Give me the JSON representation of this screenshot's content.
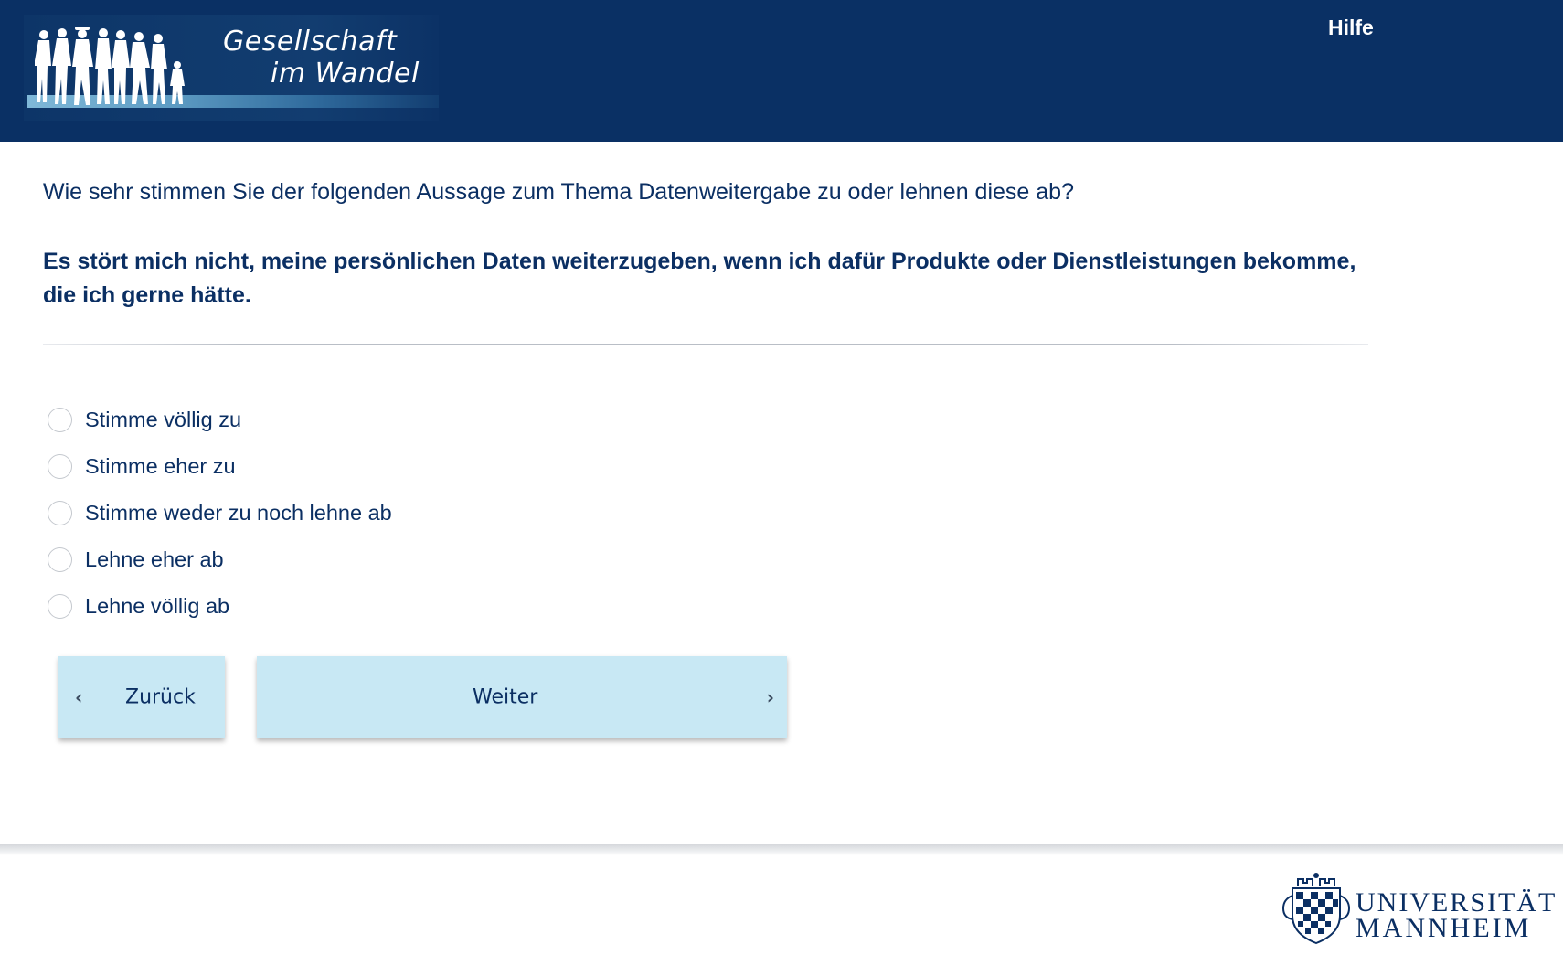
{
  "header": {
    "logo": {
      "line1": "Gesellschaft",
      "line2": "im Wandel"
    },
    "help_label": "Hilfe"
  },
  "question": {
    "text": "Wie sehr stimmen Sie der folgenden Aussage zum Thema Datenweitergabe zu oder lehnen diese ab?",
    "statement": "Es stört mich nicht, meine persönlichen Daten weiterzugeben, wenn ich dafür Produkte oder Dienstleistungen bekomme, die ich gerne hätte."
  },
  "options": [
    {
      "label": "Stimme völlig zu",
      "selected": false
    },
    {
      "label": "Stimme eher zu",
      "selected": false
    },
    {
      "label": "Stimme weder zu noch lehne ab",
      "selected": false
    },
    {
      "label": "Lehne eher ab",
      "selected": false
    },
    {
      "label": "Lehne völlig ab",
      "selected": false
    }
  ],
  "navigation": {
    "back_label": "Zurück",
    "next_label": "Weiter"
  },
  "footer": {
    "university_line1": "UNIVERSITÄT",
    "university_line2": "MANNHEIM"
  },
  "colors": {
    "header_bg": "#0a3064",
    "text": "#0b2f63",
    "button_bg": "#c8e8f4"
  }
}
